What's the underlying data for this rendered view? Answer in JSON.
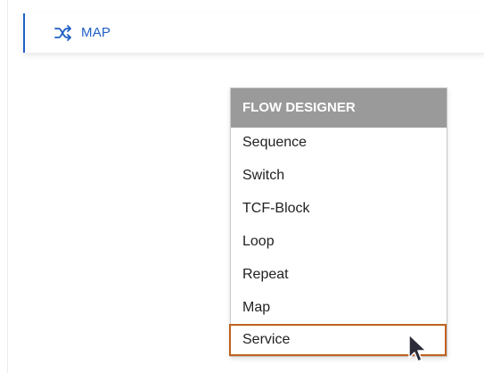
{
  "step": {
    "label": "MAP",
    "icon": "shuffle-icon",
    "accent_color": "#1f5fc4"
  },
  "menu": {
    "header": "FLOW DESIGNER",
    "header_color": "#9a9a9a",
    "highlight_color": "#c0621e",
    "items": [
      {
        "label": "Sequence"
      },
      {
        "label": "Switch"
      },
      {
        "label": "TCF-Block"
      },
      {
        "label": "Loop"
      },
      {
        "label": "Repeat"
      },
      {
        "label": "Map"
      },
      {
        "label": "Service"
      }
    ],
    "highlighted_item": "Service"
  },
  "cursor": {
    "icon": "mouse-pointer-icon"
  }
}
